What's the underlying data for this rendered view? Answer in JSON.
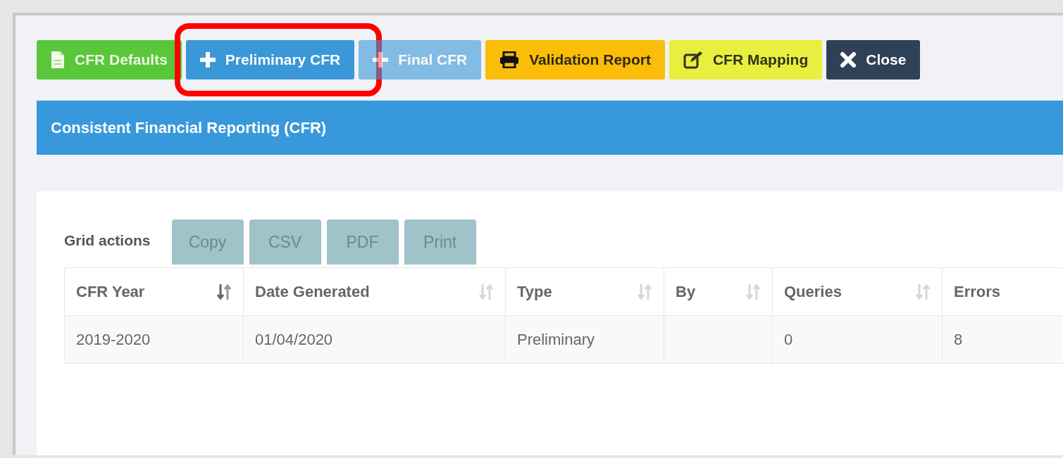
{
  "toolbar": [
    {
      "label": "CFR Defaults",
      "kind": "defaults",
      "disabled": false,
      "highlighted": false
    },
    {
      "label": "Preliminary CFR",
      "kind": "add",
      "disabled": false,
      "highlighted": true
    },
    {
      "label": "Final CFR",
      "kind": "add",
      "disabled": true,
      "highlighted": false
    },
    {
      "label": "Validation Report",
      "kind": "report",
      "disabled": false,
      "highlighted": false
    },
    {
      "label": "CFR Mapping",
      "kind": "mapping",
      "disabled": false,
      "highlighted": false
    },
    {
      "label": "Close",
      "kind": "close",
      "disabled": false,
      "highlighted": false
    }
  ],
  "header": {
    "title": "Consistent Financial Reporting (CFR)"
  },
  "grid_actions": {
    "label": "Grid actions",
    "buttons": [
      "Copy",
      "CSV",
      "PDF",
      "Print"
    ]
  },
  "table": {
    "columns": [
      {
        "label": "CFR Year",
        "sorted": true
      },
      {
        "label": "Date Generated",
        "sorted": false
      },
      {
        "label": "Type",
        "sorted": false
      },
      {
        "label": "By",
        "sorted": false
      },
      {
        "label": "Queries",
        "sorted": false
      },
      {
        "label": "Errors"
      }
    ],
    "rows": [
      [
        "2019-2020",
        "01/04/2020",
        "Preliminary",
        "",
        "0",
        "8"
      ]
    ]
  }
}
